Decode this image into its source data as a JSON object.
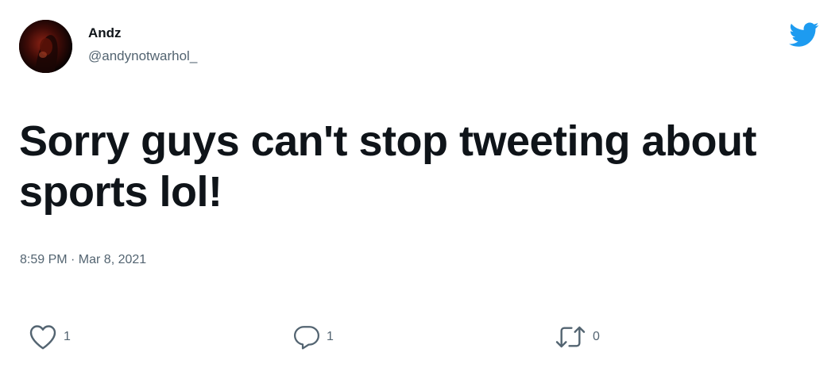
{
  "user": {
    "display_name": "Andz",
    "handle": "@andynotwarhol_"
  },
  "tweet": {
    "text": "Sorry guys can't stop tweeting about sports lol!",
    "timestamp": "8:59 PM · Mar 8, 2021"
  },
  "actions": {
    "like_count": "1",
    "reply_count": "1",
    "retweet_count": "0"
  },
  "icons": {
    "brand": "twitter-bird-icon",
    "like": "heart-icon",
    "reply": "reply-bubble-icon",
    "retweet": "retweet-icon"
  },
  "colors": {
    "brand_blue": "#1d9bf0",
    "text_primary": "#0f1419",
    "text_secondary": "#536471",
    "background": "#ffffff"
  }
}
